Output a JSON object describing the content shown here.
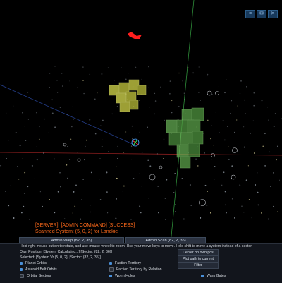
{
  "top_buttons": [
    {
      "name": "menu-icon",
      "glyph": "≡"
    },
    {
      "name": "mail-icon",
      "glyph": "✉"
    },
    {
      "name": "close-icon",
      "glyph": "✕"
    }
  ],
  "log": {
    "server_message": "[SERVER]: [ADMIN COMMAND] [SUCCESS]",
    "scanned_message": "Scanned System: (5, 0, 2) for Lanckie"
  },
  "actions": {
    "admin_warp": "Admin Warp (82, 2, 35)",
    "admin_scan": "Admin Scan (82, 2, 35)"
  },
  "info": {
    "help_text": "Hold right mouse button to rotate, and use mouse wheel to zoom. Use your move keys to move. Hold shift to move a system instead of a sector.",
    "own_position": "Own Position: [System Calculating...] [Sector: (82, 2, 36)]",
    "selected": "Selected: [System Vr (5, 0, 2)] [Sector: (82, 2, 35)]"
  },
  "side_buttons": {
    "center": "Center on own pos",
    "plot": "Plot path to current",
    "filter": "Filter"
  },
  "options": {
    "planet_orbits": "Planet Orbits",
    "asteroid_belt_orbits": "Asteroid Belt Orbits",
    "orbital_sectors": "Orbital Sectors",
    "faction_territory": "Faction Territory",
    "faction_territory_relation": "Faction Territory by Relation",
    "worm_holes": "Worm Holes",
    "warp_gates": "Warp Gates"
  },
  "colors": {
    "log_text": "#ff6a1a",
    "yellow_sector": "#cfd24a",
    "green_sector": "#5fa84d",
    "pointer_arrow": "#ff1e1e",
    "checkbox_on": "#4a90d9"
  }
}
